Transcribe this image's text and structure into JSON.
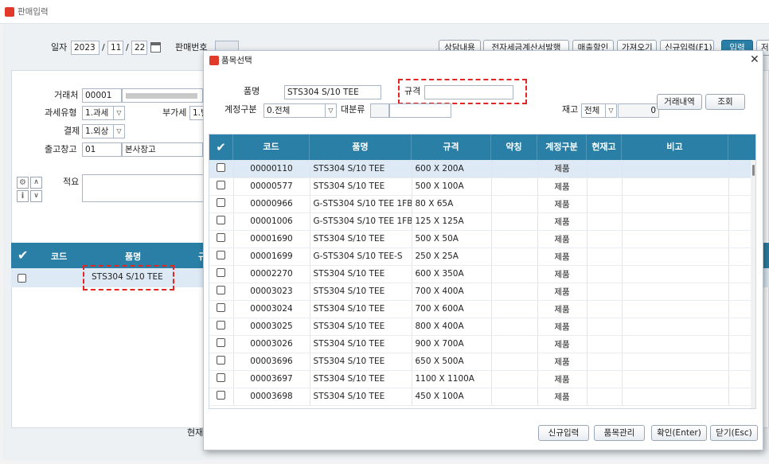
{
  "window": {
    "title": "판매입력"
  },
  "form": {
    "date_label": "일자",
    "year": "2023",
    "month": "11",
    "day": "22",
    "sale_no_label": "판매번호",
    "customer_label": "거래처",
    "customer_code": "00001",
    "tax_type_label": "과세유형",
    "tax_type_value": "1.과세",
    "vat_label": "부가세",
    "vat_value": "1.별",
    "payment_label": "결제",
    "payment_value": "1.외상",
    "warehouse_label": "출고창고",
    "warehouse_code": "01",
    "warehouse_name": "본사창고",
    "memo_label": "적요",
    "current_label": "현재"
  },
  "toolbar": {
    "consult": "상담내용",
    "etax": "전자세금계산서발행",
    "discount": "매출할인",
    "import": "가져오기",
    "new_input": "신규입력(F1)",
    "input": "입력",
    "save_partial": "저"
  },
  "main_grid": {
    "headers": {
      "code": "코드",
      "item": "품명",
      "spec_partial": "규"
    },
    "row1": {
      "item": "STS304 S/10 TEE"
    }
  },
  "dialog": {
    "title": "품목선택",
    "item_name_label": "품명",
    "item_name_value": "STS304 S/10 TEE",
    "spec_label": "규격",
    "spec_value": "",
    "account_type_label": "계정구분",
    "account_type_value": "0.전체",
    "major_cat_label": "대분류",
    "stock_label": "재고",
    "stock_value": "전체",
    "stock_qty": "0",
    "trade_history_button": "거래내역",
    "search_button": "조회",
    "columns": {
      "code": "코드",
      "name": "품명",
      "spec": "규격",
      "nickname": "약칭",
      "account": "계정구분",
      "stock": "현재고",
      "note": "비고"
    },
    "rows": [
      {
        "code": "00000110",
        "name": "STS304 S/10 TEE",
        "spec": "600 X 200A",
        "account": "제품"
      },
      {
        "code": "00000577",
        "name": "STS304 S/10 TEE",
        "spec": "500 X 100A",
        "account": "제품"
      },
      {
        "code": "00000966",
        "name": "G-STS304 S/10 TEE 1FB",
        "spec": "80 X 65A",
        "account": "제품"
      },
      {
        "code": "00001006",
        "name": "G-STS304 S/10 TEE 1FB",
        "spec": "125 X 125A",
        "account": "제품"
      },
      {
        "code": "00001690",
        "name": "STS304 S/10 TEE",
        "spec": "500 X 50A",
        "account": "제품"
      },
      {
        "code": "00001699",
        "name": "G-STS304 S/10 TEE-S",
        "spec": "250 X 25A",
        "account": "제품"
      },
      {
        "code": "00002270",
        "name": "STS304 S/10 TEE",
        "spec": "600 X 350A",
        "account": "제품"
      },
      {
        "code": "00003023",
        "name": "STS304 S/10 TEE",
        "spec": "700 X 400A",
        "account": "제품"
      },
      {
        "code": "00003024",
        "name": "STS304 S/10 TEE",
        "spec": "700 X 600A",
        "account": "제품"
      },
      {
        "code": "00003025",
        "name": "STS304 S/10 TEE",
        "spec": "800 X 400A",
        "account": "제품"
      },
      {
        "code": "00003026",
        "name": "STS304 S/10 TEE",
        "spec": "900 X 700A",
        "account": "제품"
      },
      {
        "code": "00003696",
        "name": "STS304 S/10 TEE",
        "spec": "650 X 500A",
        "account": "제품"
      },
      {
        "code": "00003697",
        "name": "STS304 S/10 TEE",
        "spec": "1100 X 1100A",
        "account": "제품"
      },
      {
        "code": "00003698",
        "name": "STS304 S/10 TEE",
        "spec": "450 X 100A",
        "account": "제품"
      }
    ],
    "footer": {
      "new_input": "신규입력",
      "item_manage": "품목관리",
      "confirm": "확인(Enter)",
      "close": "닫기(Esc)"
    }
  },
  "colors": {
    "header_blue": "#2a7fa6",
    "highlight_red": "#e12626",
    "selected_row": "#dde9f4"
  }
}
